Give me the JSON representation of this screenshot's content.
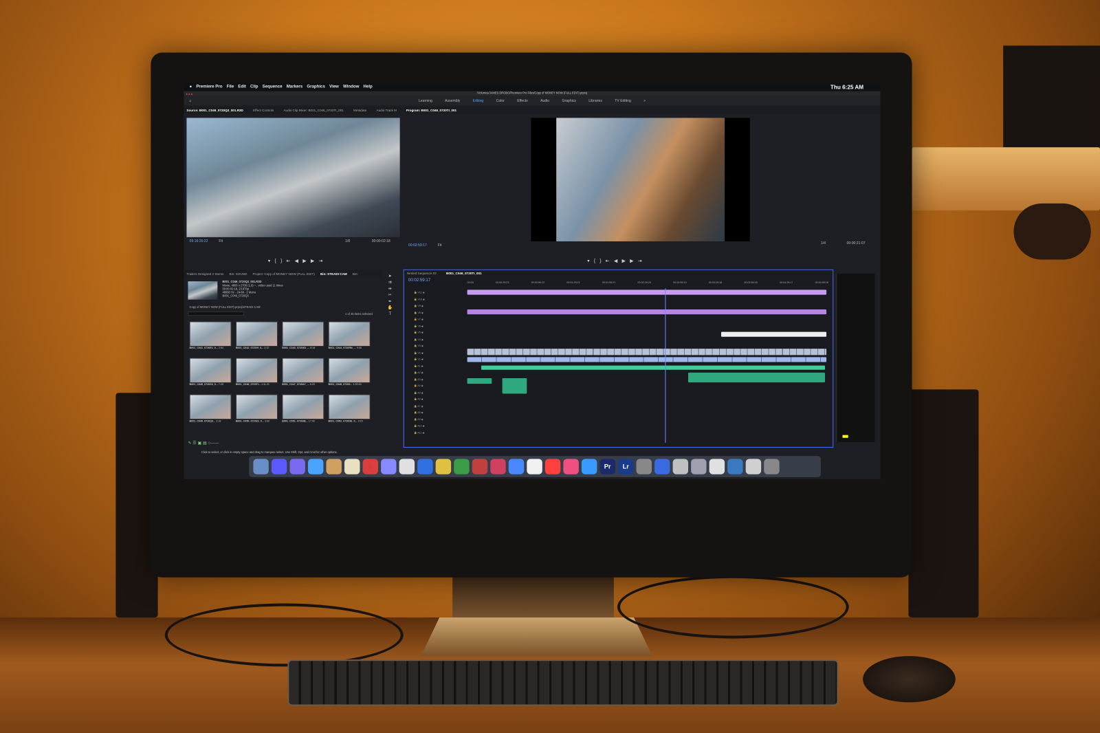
{
  "menubar": {
    "items": [
      "Premiere Pro",
      "File",
      "Edit",
      "Clip",
      "Sequence",
      "Markers",
      "Graphics",
      "View",
      "Window",
      "Help"
    ],
    "clock": "Thu 6:25 AM"
  },
  "titlebar": {
    "path": "/Volumes/JAMES DROBO/Premiere Pro Files/Copy of MONEY NOW (FULL EDIT).prproj"
  },
  "workspaces": {
    "items": [
      "Learning",
      "Assembly",
      "Editing",
      "Color",
      "Effects",
      "Audio",
      "Graphics",
      "Libraries",
      "TV Editing"
    ],
    "active": "Editing",
    "more": "»"
  },
  "source": {
    "tabs": [
      "Source: B001_C049_0720Q3_001.R3D",
      "Effect Controls",
      "Audio Clip Mixer: B001_C046_0720TI_001",
      "Metadata",
      "Audio Track M"
    ],
    "timecode": "09:16:26:22",
    "fit": "Fit",
    "resolution": "1/8",
    "duration": "00:00:02:18"
  },
  "program": {
    "tab": "Program: B001_C046_0720TI_001",
    "timecode": "00:02:59:17",
    "fit": "Fit",
    "resolution": "1/4",
    "duration": "00:00:21:07"
  },
  "project": {
    "tabs": [
      "Trailers Designed 2 Stems",
      "Bin: SOUND",
      "Project: Copy of MONEY NOW (FULL EDIT)",
      "Bin: STEADI CAM",
      "Bin:"
    ],
    "clip_info": [
      "B001_C049_0720Q3_001.R3D",
      "Movie, 4800 x 2700 (1.0) ~ , video used 11 times",
      "00:00:02:18, 23.976p",
      "48000 Hz - 24-bit - 2 Mono",
      "B001_C049_0720Q3"
    ],
    "bin_path": "Copy of MONEY NOW (FULL EDIT).prproj\\STEADI CAM",
    "selection": "1 of 46 items selected",
    "items": [
      {
        "name": "B001_C041_0720E1_0...",
        "dur": "2:54"
      },
      {
        "name": "B001_C042_0720VI_0...",
        "dur": "2:22"
      },
      {
        "name": "B001_C043_0720XD_...",
        "dur": "8:16"
      },
      {
        "name": "B001_C044_0720RN_...",
        "dur": "9:05"
      },
      {
        "name": "B001_C045_0720S3_0...",
        "dur": "7:20"
      },
      {
        "name": "B001_C046_0720TI...",
        "dur": "1:11:21"
      },
      {
        "name": "B001_C047_0720A7_...",
        "dur": "6:20"
      },
      {
        "name": "B001_C048_07200...",
        "dur": "1:20:00"
      },
      {
        "name": "B001_C049_0720Q3...",
        "dur": "2:18"
      },
      {
        "name": "B001_C050_072022_0...",
        "dur": "3:60"
      },
      {
        "name": "B001_C051_07202B...",
        "dur": "17:02"
      },
      {
        "name": "B001_C052_0720DE_0...",
        "dur": "3:15"
      }
    ]
  },
  "timeline": {
    "tabs": [
      "Nested Sequence 03",
      "B001_C046_0720TI_001"
    ],
    "timecode": "00:02:59:17",
    "ruler": [
      "00:00",
      "00:00:29:23",
      "00:00:59:22",
      "00:01:29:21",
      "00:01:59:21",
      "00:02:29:20",
      "00:02:59:19",
      "00:03:29:18",
      "00:03:59:18",
      "00:04:29:17",
      "00:04:59:16"
    ],
    "video_tracks": [
      "V11",
      "V10",
      "V9",
      "V8",
      "V7",
      "V6",
      "V5",
      "V4",
      "V3",
      "V2",
      "V1"
    ],
    "audio_tracks": [
      "A1",
      "A2",
      "A3",
      "A4",
      "A5",
      "A6",
      "A7",
      "A8",
      "A9",
      "A10",
      "A11"
    ]
  },
  "status": {
    "hint": "Click to select, or click in empty space and drag to marquee select. Use Shift, Opt, and Cmd for other options."
  },
  "dock": {
    "apps": [
      "Finder",
      "Siri",
      "Launchpad",
      "Safari",
      "Preview",
      "Notes",
      "Calendar",
      "Stickies",
      "Reminders",
      "TextEdit",
      "Photos",
      "Messages",
      "FaceTime",
      "Books",
      "Numbers",
      "Keynote",
      "News",
      "Music",
      "App Store",
      "Pr",
      "Lr",
      "System Preferences",
      "Finder2",
      "Migration",
      "QuickTime",
      "Screenshot",
      "Downloads",
      "Documents",
      "Trash"
    ],
    "calendar_day": "6"
  },
  "colors": {
    "accent": "#4aa3ff",
    "timeline_purple": "#c99bf0",
    "audio_green": "#3ecf9a",
    "video_blue": "#9fb6e8"
  }
}
